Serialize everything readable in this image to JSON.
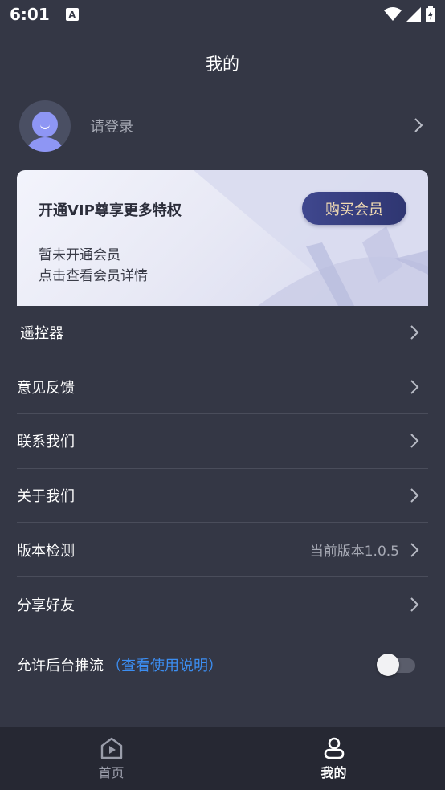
{
  "status_bar": {
    "time": "6:01",
    "app_icon_letter": "A",
    "icons": [
      "wifi-icon",
      "signal-icon",
      "battery-icon"
    ]
  },
  "header": {
    "title": "我的"
  },
  "profile": {
    "login_label": "请登录"
  },
  "vip": {
    "title": "开通VIP尊享更多特权",
    "buy_label": "购买会员",
    "status_line1": "暂未开通会员",
    "status_line2": "点击查看会员详情"
  },
  "menu": {
    "items": [
      {
        "label": "遥控器",
        "value": ""
      },
      {
        "label": "意见反馈",
        "value": ""
      },
      {
        "label": "联系我们",
        "value": ""
      },
      {
        "label": "关于我们",
        "value": ""
      },
      {
        "label": "版本检测",
        "value": "当前版本1.0.5"
      },
      {
        "label": "分享好友",
        "value": ""
      }
    ]
  },
  "push": {
    "label": "允许后台推流",
    "link": "（查看使用说明）",
    "enabled": false
  },
  "tabs": [
    {
      "label": "首页",
      "icon": "home-play-icon",
      "active": false
    },
    {
      "label": "我的",
      "icon": "profile-icon",
      "active": true
    }
  ],
  "colors": {
    "background": "#343745",
    "tab_bar": "#262833",
    "link": "#3c8ef2",
    "vip_button": "#3f478e",
    "vip_button_text": "#f2dcb3"
  }
}
